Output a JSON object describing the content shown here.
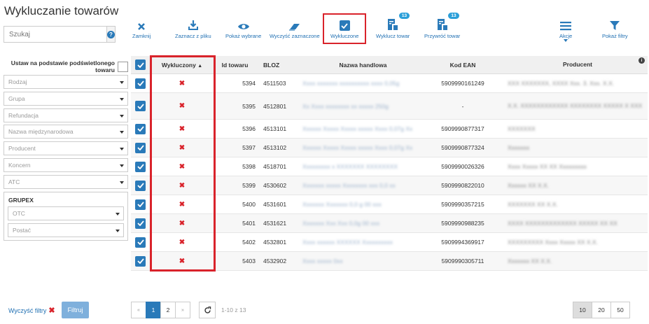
{
  "title": "Wykluczanie towarów",
  "search": {
    "placeholder": "Szukaj"
  },
  "highlight_label": "Ustaw na podstawie podświetlonego towaru",
  "filters": [
    "Rodzaj",
    "Grupa",
    "Refundacja",
    "Nazwa międzynarodowa",
    "Producent",
    "Koncern",
    "ATC"
  ],
  "grupex": {
    "title": "GRUPEX",
    "filters": [
      "OTC",
      "Postać"
    ]
  },
  "toolbar": {
    "close": "Zamknij",
    "mark_file": "Zaznacz z pliku",
    "show_selected": "Pokaż wybrane",
    "clear_selected": "Wyczyść zaznaczone",
    "excluded": "Wykluczone",
    "exclude_item": "Wyklucz towar",
    "exclude_badge": "13",
    "restore_item": "Przywróć towar",
    "restore_badge": "13",
    "actions": "Akcje",
    "show_filters": "Pokaż filtry"
  },
  "table": {
    "headers": {
      "excluded": "Wykluczony",
      "id": "Id towaru",
      "bloz": "BLOZ",
      "name": "Nazwa handlowa",
      "ean": "Kod EAN",
      "producer": "Producent"
    },
    "rows": [
      {
        "id": "5394",
        "bloz": "4511503",
        "name": "Xxxx xxxxxxx xxxxxxxxxx xxxx 0,05g",
        "ean": "5909990161249",
        "producer": "XXX XXXXXXX, XXXX Xxx. 3. Xxx. X.X."
      },
      {
        "id": "5395",
        "bloz": "4512801",
        "name": "Xx Xxxx xxxxxxxx xx xxxxx 250g",
        "ean": "-",
        "producer": "X.X. XXXXXXXXXXXX XXXXXXXX XXXXX X XXX"
      },
      {
        "id": "5396",
        "bloz": "4513101",
        "name": "Xxxxxx Xxxxx Xxxxx xxxxx Xxxx 0,07g Xx",
        "ean": "5909990877317",
        "producer": "XXXXXXX"
      },
      {
        "id": "5397",
        "bloz": "4513102",
        "name": "Xxxxxx Xxxxx Xxxxx xxxxx Xxxx 0,07g Xx",
        "ean": "5909990877324",
        "producer": "Xxxxxxx"
      },
      {
        "id": "5398",
        "bloz": "4518701",
        "name": "Xxxxxxxxx x XXXXXXX XXXXXXXX",
        "ean": "5909990026326",
        "producer": "Xxxx Xxxxx XX XX Xxxxxxxxx"
      },
      {
        "id": "5399",
        "bloz": "4530602",
        "name": "Xxxxxxx xxxxx Xxxxxxxx xxx 0,0 xx",
        "ean": "5909990822010",
        "producer": "Xxxxxx XX X.X."
      },
      {
        "id": "5400",
        "bloz": "4531601",
        "name": "Xxxxxxx Xxxxxxx 0,0 g 00 xxx",
        "ean": "5909990357215",
        "producer": "XXXXXXX XX X.X."
      },
      {
        "id": "5401",
        "bloz": "4531621",
        "name": "Xxxxxxx Xxx Xxx 0,0g 00 xxx",
        "ean": "5909990988235",
        "producer": "XXXX XXXXXXXXXXXXX XXXXX XX XX"
      },
      {
        "id": "5402",
        "bloz": "4532801",
        "name": "Xxxx xxxxxx XXXXXX Xxxxxxxxxx",
        "ean": "5909994369917",
        "producer": "XXXXXXXXX Xxxx Xxxxx XX X.X."
      },
      {
        "id": "5403",
        "bloz": "4532902",
        "name": "Xxxx xxxxx 0xx",
        "ean": "5909990305711",
        "producer": "Xxxxxxx XX X.X."
      }
    ]
  },
  "footer": {
    "clear_filters": "Wyczyść filtry",
    "filter_button": "Filtruj",
    "pages": [
      "1",
      "2"
    ],
    "prev": "«",
    "next": "»",
    "count": "1-10 z 13",
    "page_sizes": [
      "10",
      "20",
      "50"
    ]
  },
  "colors": {
    "accent": "#2a7ab9",
    "highlight": "#d9232b",
    "link": "#1f6fb2"
  }
}
